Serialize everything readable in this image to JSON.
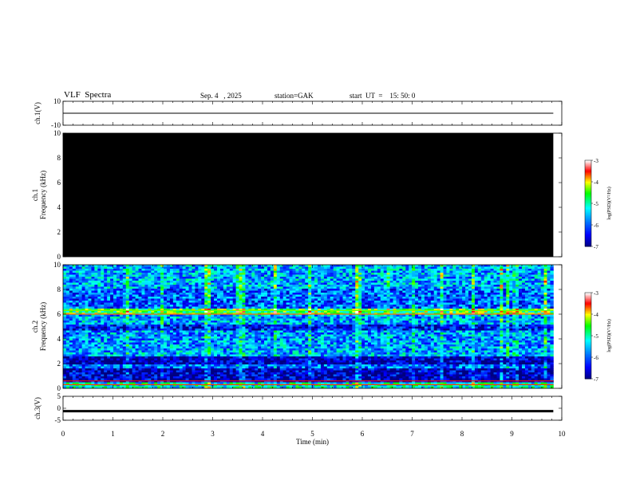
{
  "header": {
    "title": "VLF  Spectra",
    "date": "Sep. 4   , 2025",
    "station": "station=GAK",
    "start": "start  UT  =    15: 50: 0"
  },
  "chart_data": [
    {
      "type": "line",
      "panel": "ch1-waveform",
      "ylabel": "ch.1(V)",
      "ylim": [
        -10,
        10
      ],
      "yticks": [
        "10",
        "-10"
      ],
      "xlim": [
        0,
        10
      ],
      "series": [
        {
          "x": [
            0,
            9.83
          ],
          "y": [
            0,
            0
          ]
        }
      ]
    },
    {
      "type": "heatmap",
      "panel": "ch1-spectrogram",
      "ylabel_top": "ch.1",
      "ylabel": "Frequency  (kHz)",
      "ylim": [
        0,
        10
      ],
      "yticks": [
        "0",
        "2",
        "4",
        "6",
        "8",
        "10"
      ],
      "xlim": [
        0,
        10
      ],
      "data_end_min": 9.83,
      "fill": "no-signal (black)",
      "colorbar": {
        "label": "log(PSD)(V²/Hz)",
        "range": [
          -7,
          -3
        ],
        "ticks": [
          "-3",
          "-4",
          "-5",
          "-6",
          "-7"
        ]
      }
    },
    {
      "type": "heatmap",
      "panel": "ch2-spectrogram",
      "ylabel_top": "ch.2",
      "ylabel": "Frequency  (kHz)",
      "ylim": [
        0,
        10
      ],
      "yticks": [
        "0",
        "2",
        "4",
        "6",
        "8",
        "10"
      ],
      "xlim": [
        0,
        10
      ],
      "data_end_min": 9.83,
      "colorbar": {
        "label": "log(PSD)(V²/Hz)",
        "range": [
          -7,
          -3
        ],
        "ticks": [
          "-3",
          "-4",
          "-5",
          "-6",
          "-7"
        ]
      },
      "bands_khz": [
        {
          "from": 0,
          "to": 0.5,
          "level": -5.2
        },
        {
          "from": 0.5,
          "to": 1.6,
          "level": -6.7
        },
        {
          "from": 1.6,
          "to": 2.0,
          "level": -6.0
        },
        {
          "from": 2.0,
          "to": 2.6,
          "level": -6.8
        },
        {
          "from": 2.6,
          "to": 3.4,
          "level": -5.6
        },
        {
          "from": 3.4,
          "to": 4.6,
          "level": -5.7
        },
        {
          "from": 4.6,
          "to": 5.2,
          "level": -6.4
        },
        {
          "from": 5.2,
          "to": 5.9,
          "level": -5.6
        },
        {
          "from": 5.9,
          "to": 6.4,
          "level": -4.6
        },
        {
          "from": 6.4,
          "to": 8.0,
          "level": -6.0
        },
        {
          "from": 8.0,
          "to": 10.0,
          "level": -5.6
        }
      ],
      "lines_khz": [
        {
          "f": 0.3,
          "level": -3.6
        },
        {
          "f": 0.6,
          "level": -3.5
        },
        {
          "f": 6.0,
          "level": -3.7
        },
        {
          "f": 6.3,
          "level": -4.3
        }
      ]
    },
    {
      "type": "line",
      "panel": "ch3-waveform",
      "ylabel": "ch.3(V)",
      "ylim": [
        -5,
        5
      ],
      "yticks": [
        "5",
        "0",
        "-5"
      ],
      "xlim": [
        0,
        10
      ],
      "xticks": [
        "0",
        "1",
        "2",
        "3",
        "4",
        "5",
        "6",
        "7",
        "8",
        "9",
        "10"
      ],
      "xlabel": "Time  (min)",
      "series": [
        {
          "x": [
            0,
            9.83
          ],
          "y": [
            -1.2,
            -1.2
          ]
        }
      ]
    }
  ],
  "colors": {
    "no_signal": "#000000",
    "axis": "#000000"
  },
  "colormap": [
    [
      0.0,
      "#000080"
    ],
    [
      0.14,
      "#0000ff"
    ],
    [
      0.3,
      "#0080ff"
    ],
    [
      0.45,
      "#00ffff"
    ],
    [
      0.62,
      "#00ff00"
    ],
    [
      0.75,
      "#ffff00"
    ],
    [
      0.88,
      "#ff0000"
    ],
    [
      1.0,
      "#ffffff"
    ]
  ]
}
